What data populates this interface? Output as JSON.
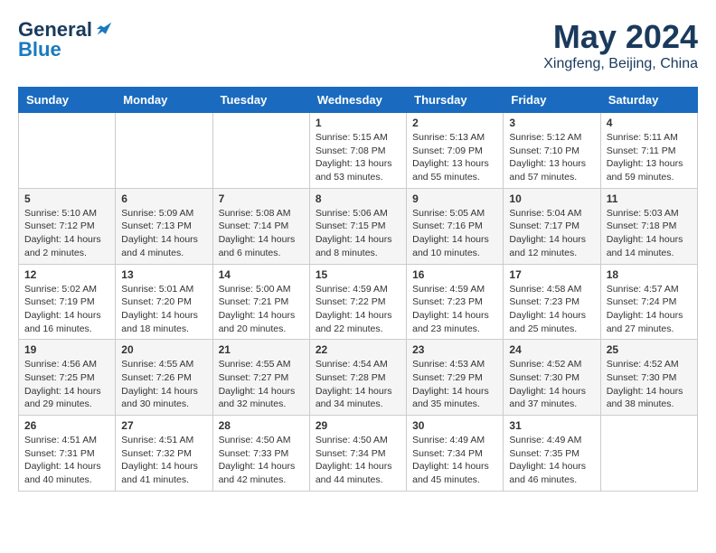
{
  "logo": {
    "general": "General",
    "blue": "Blue"
  },
  "header": {
    "title": "May 2024",
    "subtitle": "Xingfeng, Beijing, China"
  },
  "weekdays": [
    "Sunday",
    "Monday",
    "Tuesday",
    "Wednesday",
    "Thursday",
    "Friday",
    "Saturday"
  ],
  "weeks": [
    [
      {
        "day": "",
        "info": ""
      },
      {
        "day": "",
        "info": ""
      },
      {
        "day": "",
        "info": ""
      },
      {
        "day": "1",
        "info": "Sunrise: 5:15 AM\nSunset: 7:08 PM\nDaylight: 13 hours and 53 minutes."
      },
      {
        "day": "2",
        "info": "Sunrise: 5:13 AM\nSunset: 7:09 PM\nDaylight: 13 hours and 55 minutes."
      },
      {
        "day": "3",
        "info": "Sunrise: 5:12 AM\nSunset: 7:10 PM\nDaylight: 13 hours and 57 minutes."
      },
      {
        "day": "4",
        "info": "Sunrise: 5:11 AM\nSunset: 7:11 PM\nDaylight: 13 hours and 59 minutes."
      }
    ],
    [
      {
        "day": "5",
        "info": "Sunrise: 5:10 AM\nSunset: 7:12 PM\nDaylight: 14 hours and 2 minutes."
      },
      {
        "day": "6",
        "info": "Sunrise: 5:09 AM\nSunset: 7:13 PM\nDaylight: 14 hours and 4 minutes."
      },
      {
        "day": "7",
        "info": "Sunrise: 5:08 AM\nSunset: 7:14 PM\nDaylight: 14 hours and 6 minutes."
      },
      {
        "day": "8",
        "info": "Sunrise: 5:06 AM\nSunset: 7:15 PM\nDaylight: 14 hours and 8 minutes."
      },
      {
        "day": "9",
        "info": "Sunrise: 5:05 AM\nSunset: 7:16 PM\nDaylight: 14 hours and 10 minutes."
      },
      {
        "day": "10",
        "info": "Sunrise: 5:04 AM\nSunset: 7:17 PM\nDaylight: 14 hours and 12 minutes."
      },
      {
        "day": "11",
        "info": "Sunrise: 5:03 AM\nSunset: 7:18 PM\nDaylight: 14 hours and 14 minutes."
      }
    ],
    [
      {
        "day": "12",
        "info": "Sunrise: 5:02 AM\nSunset: 7:19 PM\nDaylight: 14 hours and 16 minutes."
      },
      {
        "day": "13",
        "info": "Sunrise: 5:01 AM\nSunset: 7:20 PM\nDaylight: 14 hours and 18 minutes."
      },
      {
        "day": "14",
        "info": "Sunrise: 5:00 AM\nSunset: 7:21 PM\nDaylight: 14 hours and 20 minutes."
      },
      {
        "day": "15",
        "info": "Sunrise: 4:59 AM\nSunset: 7:22 PM\nDaylight: 14 hours and 22 minutes."
      },
      {
        "day": "16",
        "info": "Sunrise: 4:59 AM\nSunset: 7:23 PM\nDaylight: 14 hours and 23 minutes."
      },
      {
        "day": "17",
        "info": "Sunrise: 4:58 AM\nSunset: 7:23 PM\nDaylight: 14 hours and 25 minutes."
      },
      {
        "day": "18",
        "info": "Sunrise: 4:57 AM\nSunset: 7:24 PM\nDaylight: 14 hours and 27 minutes."
      }
    ],
    [
      {
        "day": "19",
        "info": "Sunrise: 4:56 AM\nSunset: 7:25 PM\nDaylight: 14 hours and 29 minutes."
      },
      {
        "day": "20",
        "info": "Sunrise: 4:55 AM\nSunset: 7:26 PM\nDaylight: 14 hours and 30 minutes."
      },
      {
        "day": "21",
        "info": "Sunrise: 4:55 AM\nSunset: 7:27 PM\nDaylight: 14 hours and 32 minutes."
      },
      {
        "day": "22",
        "info": "Sunrise: 4:54 AM\nSunset: 7:28 PM\nDaylight: 14 hours and 34 minutes."
      },
      {
        "day": "23",
        "info": "Sunrise: 4:53 AM\nSunset: 7:29 PM\nDaylight: 14 hours and 35 minutes."
      },
      {
        "day": "24",
        "info": "Sunrise: 4:52 AM\nSunset: 7:30 PM\nDaylight: 14 hours and 37 minutes."
      },
      {
        "day": "25",
        "info": "Sunrise: 4:52 AM\nSunset: 7:30 PM\nDaylight: 14 hours and 38 minutes."
      }
    ],
    [
      {
        "day": "26",
        "info": "Sunrise: 4:51 AM\nSunset: 7:31 PM\nDaylight: 14 hours and 40 minutes."
      },
      {
        "day": "27",
        "info": "Sunrise: 4:51 AM\nSunset: 7:32 PM\nDaylight: 14 hours and 41 minutes."
      },
      {
        "day": "28",
        "info": "Sunrise: 4:50 AM\nSunset: 7:33 PM\nDaylight: 14 hours and 42 minutes."
      },
      {
        "day": "29",
        "info": "Sunrise: 4:50 AM\nSunset: 7:34 PM\nDaylight: 14 hours and 44 minutes."
      },
      {
        "day": "30",
        "info": "Sunrise: 4:49 AM\nSunset: 7:34 PM\nDaylight: 14 hours and 45 minutes."
      },
      {
        "day": "31",
        "info": "Sunrise: 4:49 AM\nSunset: 7:35 PM\nDaylight: 14 hours and 46 minutes."
      },
      {
        "day": "",
        "info": ""
      }
    ]
  ]
}
